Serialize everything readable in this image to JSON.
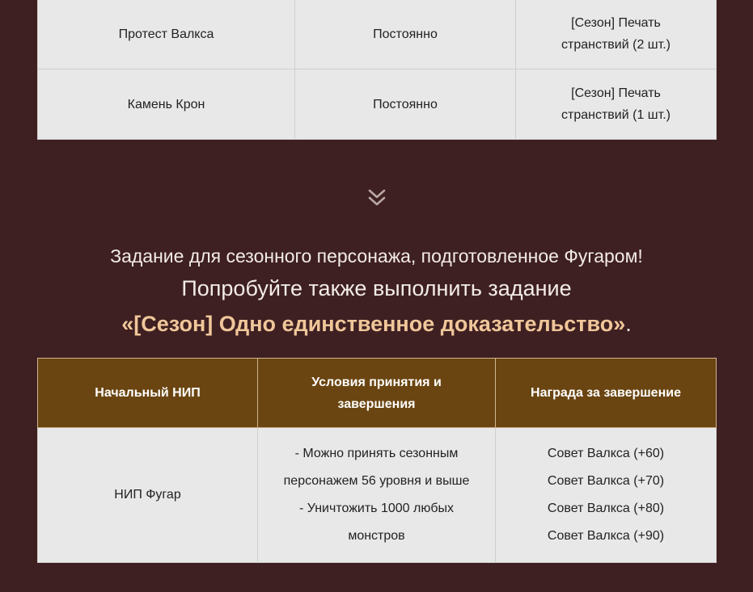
{
  "top_table": {
    "rows": [
      {
        "npc": "Протест Валкса",
        "period": "Постоянно",
        "reward_lines": [
          "[Сезон] Печать",
          "странствий (2 шт.)"
        ]
      },
      {
        "npc": "Камень Крон",
        "period": "Постоянно",
        "reward_lines": [
          "[Сезон] Печать",
          "странствий (1 шт.)"
        ]
      }
    ]
  },
  "divider": {
    "icon": "double-chevron-down-icon"
  },
  "intro": {
    "line1": "Задание для сезонного персонажа, подготовленное Фугаром!",
    "line2": "Попробуйте также выполнить задание",
    "quest_name": "«[Сезон] Одно единственное доказательство»",
    "quest_name_suffix": ".",
    "accent_color": "#f0c79a"
  },
  "quest_table": {
    "header_color": "#6b4511",
    "headers": {
      "npc_lines": [
        "Начальный НИП"
      ],
      "conditions_lines": [
        "Условия принятия и",
        "завершения"
      ],
      "reward_lines": [
        "Награда за завершение"
      ]
    },
    "row": {
      "npc": "НИП Фугар",
      "conditions_lines": [
        "- Можно принять сезонным",
        "персонажем 56 уровня и выше",
        "- Уничтожить 1000 любых",
        "монстров"
      ],
      "rewards": [
        "Совет Валкса (+60)",
        "Совет Валкса (+70)",
        "Совет Валкса (+80)",
        "Совет Валкса (+90)"
      ]
    }
  }
}
